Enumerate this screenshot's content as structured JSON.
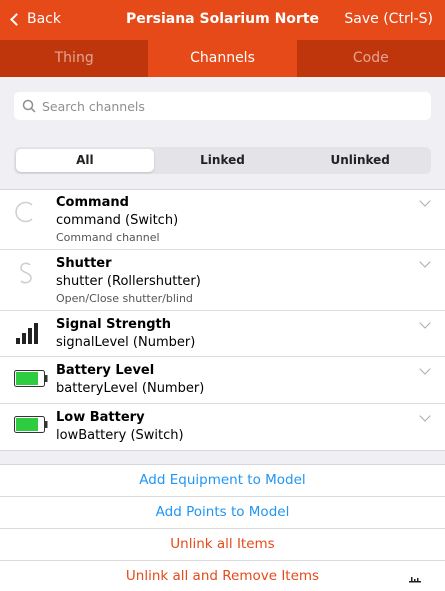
{
  "navbar": {
    "back_label": "Back",
    "title": "Persiana Solarium Norte",
    "save_label": "Save (Ctrl-S)"
  },
  "tabs": [
    {
      "label": "Thing",
      "active": false
    },
    {
      "label": "Channels",
      "active": true
    },
    {
      "label": "Code",
      "active": false
    }
  ],
  "search": {
    "placeholder": "Search channels"
  },
  "segments": [
    {
      "label": "All",
      "active": true
    },
    {
      "label": "Linked",
      "active": false
    },
    {
      "label": "Unlinked",
      "active": false
    }
  ],
  "channels": [
    {
      "title": "Command",
      "subtitle": "command (Switch)",
      "description": "Command channel",
      "icon": "power-circle-icon"
    },
    {
      "title": "Shutter",
      "subtitle": "shutter (Rollershutter)",
      "description": "Open/Close shutter/blind",
      "icon": "rollershutter-icon"
    },
    {
      "title": "Signal Strength",
      "subtitle": "signalLevel (Number)",
      "description": "",
      "icon": "signal-strength-icon"
    },
    {
      "title": "Battery Level",
      "subtitle": "batteryLevel (Number)",
      "description": "",
      "icon": "battery-icon"
    },
    {
      "title": "Low Battery",
      "subtitle": "lowBattery (Switch)",
      "description": "",
      "icon": "battery-icon"
    }
  ],
  "actions": [
    {
      "label": "Add Equipment to Model",
      "color": "#2196f3"
    },
    {
      "label": "Add Points to Model",
      "color": "#2196f3"
    },
    {
      "label": "Unlink all Items",
      "color": "#e64a19"
    },
    {
      "label": "Unlink all and Remove Items",
      "color": "#e64a19"
    }
  ],
  "colors": {
    "accent": "#e64a19",
    "tabbar": "#bf360c",
    "link_blue": "#2196f3",
    "battery_green": "#2ecc40"
  }
}
